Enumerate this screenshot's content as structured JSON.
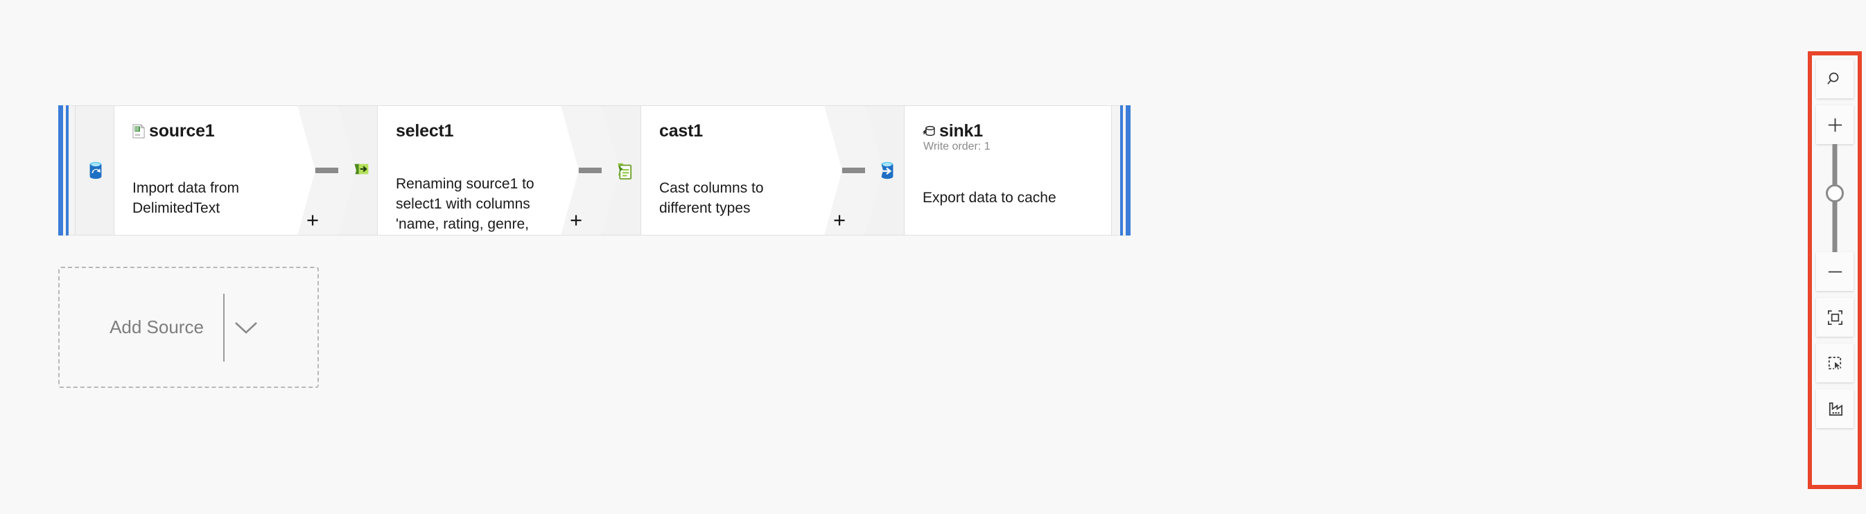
{
  "canvas": {
    "background_color": "#f8f8f8",
    "stream_rail_color": "#3b7dd8"
  },
  "stream": {
    "nodes": [
      {
        "id": "source1",
        "title": "source1",
        "title_icon": "csv-file-icon",
        "subtitle": "",
        "description": "Import data from DelimitedText",
        "icon": "azure-data-source-icon",
        "type": "source"
      },
      {
        "id": "select1",
        "title": "select1",
        "title_icon": "",
        "subtitle": "",
        "description": "Renaming source1 to select1 with columns 'name, rating, genre,",
        "icon": "select-transformation-icon",
        "type": "select"
      },
      {
        "id": "cast1",
        "title": "cast1",
        "title_icon": "",
        "subtitle": "",
        "description": "Cast columns to different types",
        "icon": "cast-transformation-icon",
        "type": "cast"
      },
      {
        "id": "sink1",
        "title": "sink1",
        "title_icon": "cache-sink-icon",
        "subtitle": "Write order: 1",
        "description": "Export data to cache",
        "icon": "azure-data-sink-icon",
        "type": "sink"
      }
    ],
    "add_node_label": "+"
  },
  "add_source": {
    "label": "Add Source",
    "caret_icon": "chevron-down-icon"
  },
  "toolbar": {
    "highlight_color": "#e8452a",
    "buttons": [
      {
        "name": "search-icon",
        "tooltip": "Search"
      },
      {
        "name": "zoom-in-icon",
        "tooltip": "Zoom in"
      },
      {
        "name": "zoom-out-icon",
        "tooltip": "Zoom out"
      },
      {
        "name": "zoom-to-fit-icon",
        "tooltip": "Zoom to fit"
      },
      {
        "name": "marquee-select-icon",
        "tooltip": "Marquee select"
      },
      {
        "name": "data-flow-debug-icon",
        "tooltip": "Data flow debug"
      }
    ],
    "zoom_slider": {
      "name": "zoom-slider",
      "value": 50
    }
  }
}
